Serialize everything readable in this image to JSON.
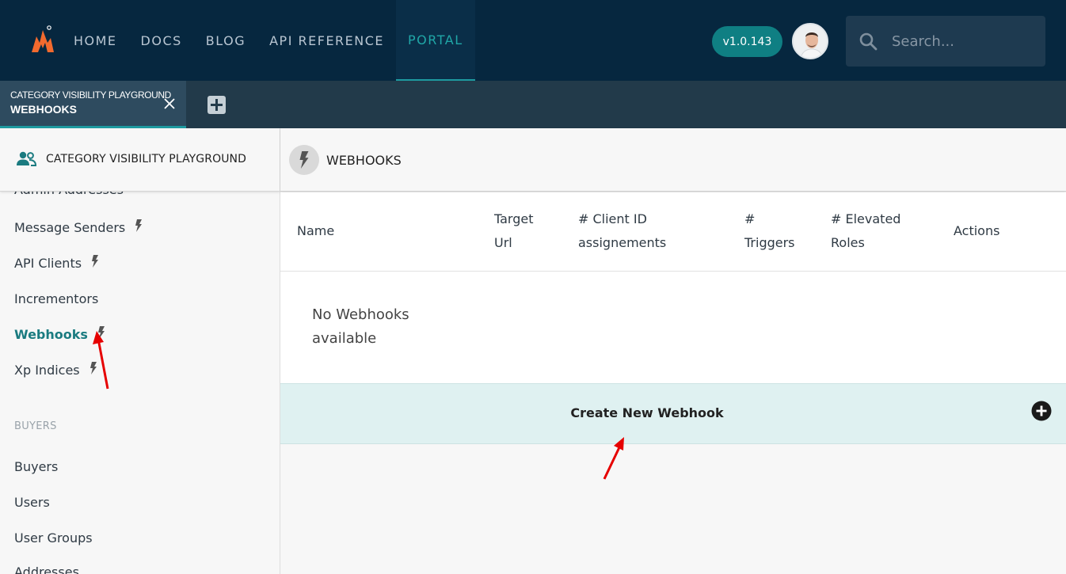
{
  "nav": {
    "items": [
      {
        "label": "HOME"
      },
      {
        "label": "DOCS"
      },
      {
        "label": "BLOG"
      },
      {
        "label": "API REFERENCE"
      },
      {
        "label": "PORTAL",
        "active": true
      }
    ],
    "version": "v1.0.143",
    "search_placeholder": "Search..."
  },
  "tabs": {
    "active": {
      "subtitle": "CATEGORY VISIBILITY PLAYGROUND",
      "title": "WEBHOOKS"
    }
  },
  "sidebar": {
    "title": "CATEGORY VISIBILITY PLAYGROUND",
    "items": [
      {
        "label": "Admin Addresses",
        "bolt": false
      },
      {
        "label": "Message Senders",
        "bolt": true
      },
      {
        "label": "API Clients",
        "bolt": true
      },
      {
        "label": "Incrementors",
        "bolt": false
      },
      {
        "label": "Webhooks",
        "bolt": true,
        "active": true
      },
      {
        "label": "Xp Indices",
        "bolt": true
      }
    ],
    "section": "BUYERS",
    "section_items": [
      {
        "label": "Buyers"
      },
      {
        "label": "Users"
      },
      {
        "label": "User Groups"
      },
      {
        "label": "Addresses"
      }
    ]
  },
  "main": {
    "title": "WEBHOOKS",
    "columns": [
      {
        "line1": "Name",
        "line2": ""
      },
      {
        "line1": "Target",
        "line2": "Url"
      },
      {
        "line1": "# Client ID",
        "line2": "assignements"
      },
      {
        "line1": "#",
        "line2": "Triggers"
      },
      {
        "line1": "# Elevated",
        "line2": "Roles"
      },
      {
        "line1": "Actions",
        "line2": ""
      }
    ],
    "empty_line1": "No Webhooks",
    "empty_line2": "available",
    "create_label": "Create New Webhook"
  },
  "colors": {
    "topbar": "#06273f",
    "accent": "#1e9aa0",
    "annotation_arrow": "#e60000"
  }
}
